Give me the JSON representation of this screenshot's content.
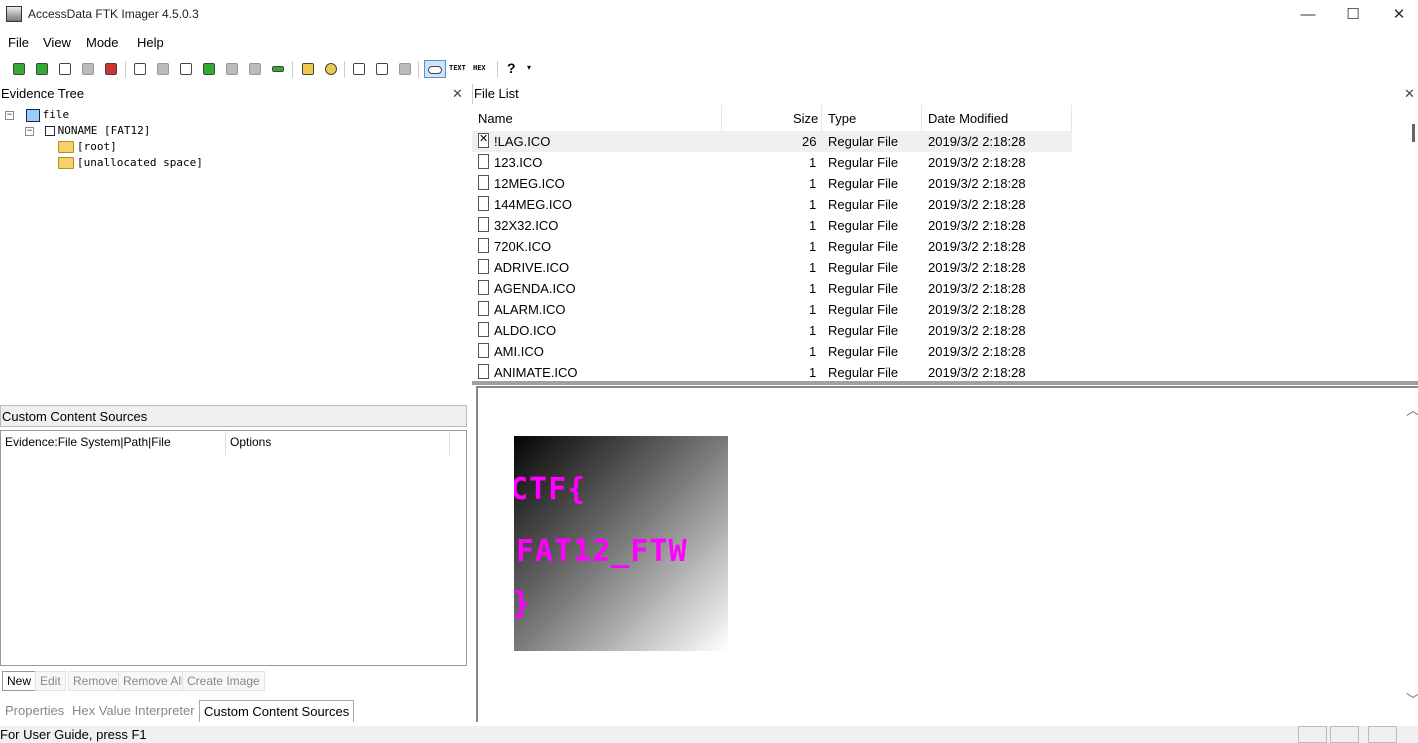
{
  "window": {
    "title": "AccessData FTK Imager 4.5.0.3",
    "controls": {
      "minimize": "—",
      "maximize": "☐",
      "close": "✕"
    }
  },
  "menu": [
    "File",
    "View",
    "Mode",
    "Help"
  ],
  "toolbar": {
    "icons": [
      "add-evidence-icon",
      "add-all-evidence-icon",
      "image-mounting-icon",
      "remove-evidence-icon",
      "remove-all-evidence-icon",
      "create-disk-image-icon",
      "export-disk-image-icon",
      "export-logical-image-icon",
      "add-to-custom-content-icon",
      "create-custom-content-image-icon",
      "decrypt-icon",
      "capture-memory-icon",
      "obtain-protected-files-icon",
      "detect-encryption-icon",
      "export-files-icon",
      "export-hash-list-icon",
      "export-directory-listing-icon",
      "natural-view-icon",
      "text-view-icon",
      "hex-view-icon",
      "help-icon"
    ],
    "text_view_label": "TEXT",
    "hex_view_label": "HEX"
  },
  "evidence_tree": {
    "title": "Evidence Tree",
    "items": [
      {
        "label": "file",
        "expander": "−"
      },
      {
        "label": "NONAME [FAT12]",
        "expander": "−"
      },
      {
        "label": "[root]"
      },
      {
        "label": "[unallocated space]"
      }
    ]
  },
  "custom_content": {
    "header": "Custom Content Sources",
    "columns": [
      "Evidence:File System|Path|File",
      "Options"
    ],
    "buttons": [
      "New",
      "Edit",
      "Remove",
      "Remove All",
      "Create Image"
    ]
  },
  "bottom_tabs": [
    "Properties",
    "Hex Value Interpreter",
    "Custom Content Sources"
  ],
  "active_tab": "Custom Content Sources",
  "file_list": {
    "title": "File List",
    "columns": [
      "Name",
      "Size",
      "Type",
      "Date Modified"
    ],
    "rows": [
      {
        "name": "!LAG.ICO",
        "size": "26",
        "type": "Regular File",
        "date": "2019/3/2 2:18:28",
        "deleted": true
      },
      {
        "name": "123.ICO",
        "size": "1",
        "type": "Regular File",
        "date": "2019/3/2 2:18:28"
      },
      {
        "name": "12MEG.ICO",
        "size": "1",
        "type": "Regular File",
        "date": "2019/3/2 2:18:28"
      },
      {
        "name": "144MEG.ICO",
        "size": "1",
        "type": "Regular File",
        "date": "2019/3/2 2:18:28"
      },
      {
        "name": "32X32.ICO",
        "size": "1",
        "type": "Regular File",
        "date": "2019/3/2 2:18:28"
      },
      {
        "name": "720K.ICO",
        "size": "1",
        "type": "Regular File",
        "date": "2019/3/2 2:18:28"
      },
      {
        "name": "ADRIVE.ICO",
        "size": "1",
        "type": "Regular File",
        "date": "2019/3/2 2:18:28"
      },
      {
        "name": "AGENDA.ICO",
        "size": "1",
        "type": "Regular File",
        "date": "2019/3/2 2:18:28"
      },
      {
        "name": "ALARM.ICO",
        "size": "1",
        "type": "Regular File",
        "date": "2019/3/2 2:18:28"
      },
      {
        "name": "ALDO.ICO",
        "size": "1",
        "type": "Regular File",
        "date": "2019/3/2 2:18:28"
      },
      {
        "name": "AMI.ICO",
        "size": "1",
        "type": "Regular File",
        "date": "2019/3/2 2:18:28"
      },
      {
        "name": "ANIMATE.ICO",
        "size": "1",
        "type": "Regular File",
        "date": "2019/3/2 2:18:28"
      }
    ]
  },
  "viewer": {
    "image_text": [
      "CTF{",
      "FAT12_FTW",
      "}"
    ],
    "text_color": "#ff00ff"
  },
  "status": {
    "text": "For User Guide, press F1"
  }
}
